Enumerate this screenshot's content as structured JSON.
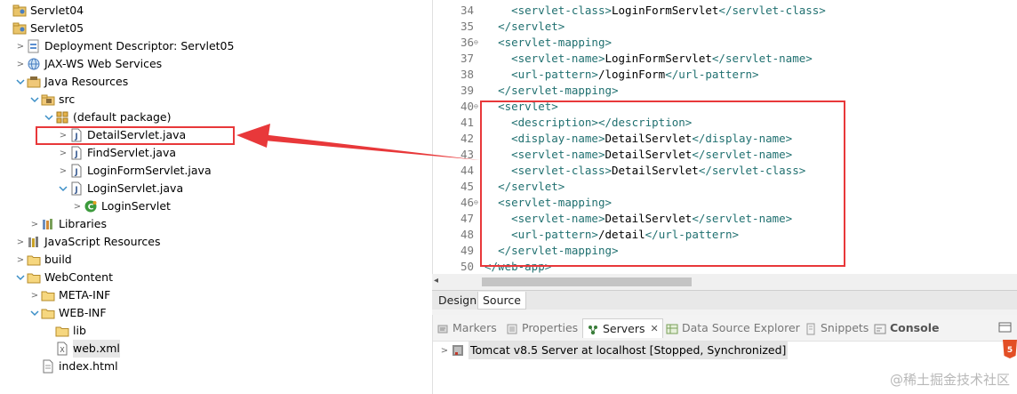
{
  "tree": {
    "items": [
      {
        "label": "Servlet04",
        "icon": "project-icon",
        "twisty": ""
      },
      {
        "label": "Servlet05",
        "icon": "project-icon",
        "twisty": ""
      },
      {
        "label": "Deployment Descriptor: Servlet05",
        "icon": "deployment-descriptor-icon",
        "twisty": ">"
      },
      {
        "label": "JAX-WS Web Services",
        "icon": "web-services-icon",
        "twisty": ">"
      },
      {
        "label": "Java Resources",
        "icon": "java-resources-icon",
        "twisty": "v"
      },
      {
        "label": "src",
        "icon": "source-folder-icon",
        "twisty": "v"
      },
      {
        "label": "(default package)",
        "icon": "package-icon",
        "twisty": "v"
      },
      {
        "label": "DetailServlet.java",
        "icon": "java-file-icon",
        "twisty": ">"
      },
      {
        "label": "FindServlet.java",
        "icon": "java-file-icon",
        "twisty": ">"
      },
      {
        "label": "LoginFormServlet.java",
        "icon": "java-file-icon",
        "twisty": ">"
      },
      {
        "label": "LoginServlet.java",
        "icon": "java-file-icon",
        "twisty": "v"
      },
      {
        "label": "LoginServlet",
        "icon": "servlet-class-icon",
        "twisty": ">"
      },
      {
        "label": "Libraries",
        "icon": "libraries-icon",
        "twisty": ">"
      },
      {
        "label": "JavaScript Resources",
        "icon": "javascript-resources-icon",
        "twisty": ">"
      },
      {
        "label": "build",
        "icon": "folder-icon",
        "twisty": ">"
      },
      {
        "label": "WebContent",
        "icon": "folder-icon",
        "twisty": "v"
      },
      {
        "label": "META-INF",
        "icon": "folder-icon",
        "twisty": ">"
      },
      {
        "label": "WEB-INF",
        "icon": "folder-icon",
        "twisty": "v"
      },
      {
        "label": "lib",
        "icon": "folder-icon",
        "twisty": ""
      },
      {
        "label": "web.xml",
        "icon": "xml-file-icon",
        "twisty": ""
      },
      {
        "label": "index.html",
        "icon": "html-file-icon",
        "twisty": ""
      }
    ]
  },
  "editor": {
    "lines": [
      {
        "n": "34",
        "fold": "",
        "code": [
          [
            "    ",
            "txt"
          ],
          [
            "<servlet-class>",
            "tag"
          ],
          [
            "LoginFormServlet",
            "txt"
          ],
          [
            "</servlet-class>",
            "tag"
          ]
        ]
      },
      {
        "n": "35",
        "fold": "",
        "code": [
          [
            "  ",
            "txt"
          ],
          [
            "</servlet>",
            "tag"
          ]
        ]
      },
      {
        "n": "36",
        "fold": "⊖",
        "code": [
          [
            "  ",
            "txt"
          ],
          [
            "<servlet-mapping>",
            "tag"
          ]
        ]
      },
      {
        "n": "37",
        "fold": "",
        "code": [
          [
            "    ",
            "txt"
          ],
          [
            "<servlet-name>",
            "tag"
          ],
          [
            "LoginFormServlet",
            "txt"
          ],
          [
            "</servlet-name>",
            "tag"
          ]
        ]
      },
      {
        "n": "38",
        "fold": "",
        "code": [
          [
            "    ",
            "txt"
          ],
          [
            "<url-pattern>",
            "tag"
          ],
          [
            "/loginForm",
            "txt"
          ],
          [
            "</url-pattern>",
            "tag"
          ]
        ]
      },
      {
        "n": "39",
        "fold": "",
        "code": [
          [
            "  ",
            "txt"
          ],
          [
            "</servlet-mapping>",
            "tag"
          ]
        ]
      },
      {
        "n": "40",
        "fold": "⊖",
        "code": [
          [
            "  ",
            "txt"
          ],
          [
            "<servlet>",
            "tag"
          ]
        ]
      },
      {
        "n": "41",
        "fold": "",
        "code": [
          [
            "    ",
            "txt"
          ],
          [
            "<description>",
            "tag"
          ],
          [
            "</description>",
            "tag"
          ]
        ]
      },
      {
        "n": "42",
        "fold": "",
        "code": [
          [
            "    ",
            "txt"
          ],
          [
            "<display-name>",
            "tag"
          ],
          [
            "DetailServlet",
            "txt"
          ],
          [
            "</display-name>",
            "tag"
          ]
        ]
      },
      {
        "n": "43",
        "fold": "",
        "code": [
          [
            "    ",
            "txt"
          ],
          [
            "<servlet-name>",
            "tag"
          ],
          [
            "DetailServlet",
            "txt"
          ],
          [
            "</servlet-name>",
            "tag"
          ]
        ]
      },
      {
        "n": "44",
        "fold": "",
        "code": [
          [
            "    ",
            "txt"
          ],
          [
            "<servlet-class>",
            "tag"
          ],
          [
            "DetailServlet",
            "txt"
          ],
          [
            "</servlet-class>",
            "tag"
          ]
        ]
      },
      {
        "n": "45",
        "fold": "",
        "code": [
          [
            "  ",
            "txt"
          ],
          [
            "</servlet>",
            "tag"
          ]
        ]
      },
      {
        "n": "46",
        "fold": "⊖",
        "code": [
          [
            "  ",
            "txt"
          ],
          [
            "<servlet-mapping>",
            "tag"
          ]
        ]
      },
      {
        "n": "47",
        "fold": "",
        "code": [
          [
            "    ",
            "txt"
          ],
          [
            "<servlet-name>",
            "tag"
          ],
          [
            "DetailServlet",
            "txt"
          ],
          [
            "</servlet-name>",
            "tag"
          ]
        ]
      },
      {
        "n": "48",
        "fold": "",
        "code": [
          [
            "    ",
            "txt"
          ],
          [
            "<url-pattern>",
            "tag"
          ],
          [
            "/detail",
            "txt"
          ],
          [
            "</url-pattern>",
            "tag"
          ]
        ]
      },
      {
        "n": "49",
        "fold": "",
        "code": [
          [
            "  ",
            "txt"
          ],
          [
            "</servlet-mapping>",
            "tag"
          ]
        ]
      },
      {
        "n": "50",
        "fold": "",
        "code": [
          [
            "</web-app>",
            "tag"
          ]
        ]
      }
    ],
    "tabs": {
      "design": "Design",
      "source": "Source"
    }
  },
  "views": {
    "tabs": {
      "markers": "Markers",
      "properties": "Properties",
      "servers": "Servers",
      "data_source": "Data Source Explorer",
      "snippets": "Snippets",
      "console": "Console"
    },
    "server_entry": "Tomcat v8.5 Server at localhost  [Stopped, Synchronized]"
  },
  "watermark": "@稀土掘金技术社区",
  "colors": {
    "annotation": "#e8383a",
    "xml_tag": "#207070"
  }
}
